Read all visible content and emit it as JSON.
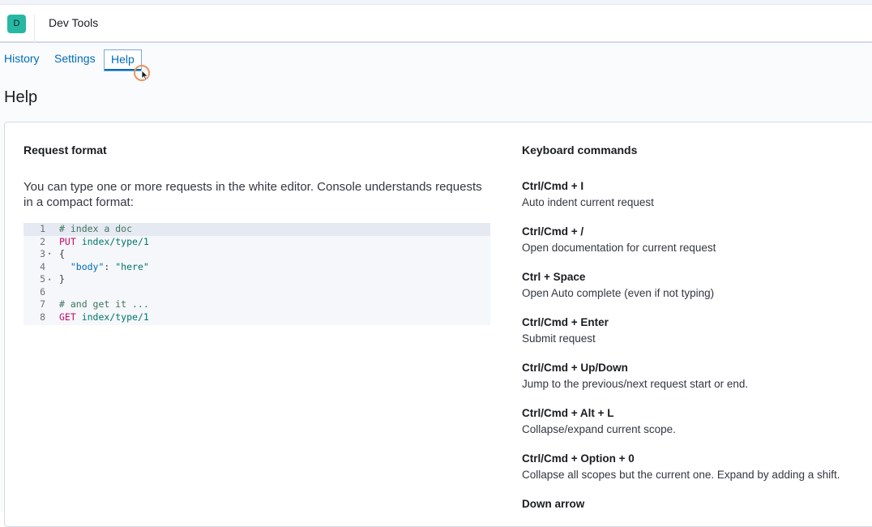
{
  "header": {
    "avatar_letter": "D",
    "app_title": "Dev Tools"
  },
  "tabs": [
    {
      "label": "History"
    },
    {
      "label": "Settings"
    },
    {
      "label": "Help",
      "selected": true
    }
  ],
  "page_title": "Help",
  "request_format": {
    "title": "Request format",
    "intro": "You can type one or more requests in the white editor. Console understands requests in a compact format:",
    "code": [
      {
        "n": "1",
        "fold": "",
        "text": "# index a doc"
      },
      {
        "n": "2",
        "fold": "",
        "text": "PUT index/type/1"
      },
      {
        "n": "3",
        "fold": "▾",
        "text": "{"
      },
      {
        "n": "4",
        "fold": "",
        "text": "  \"body\": \"here\""
      },
      {
        "n": "5",
        "fold": "▴",
        "text": "}"
      },
      {
        "n": "6",
        "fold": "",
        "text": ""
      },
      {
        "n": "7",
        "fold": "",
        "text": "# and get it ..."
      },
      {
        "n": "8",
        "fold": "",
        "text": "GET index/type/1"
      }
    ]
  },
  "keyboard_commands": {
    "title": "Keyboard commands",
    "items": [
      {
        "key": "Ctrl/Cmd + I",
        "desc": "Auto indent current request"
      },
      {
        "key": "Ctrl/Cmd + /",
        "desc": "Open documentation for current request"
      },
      {
        "key": "Ctrl + Space",
        "desc": "Open Auto complete (even if not typing)"
      },
      {
        "key": "Ctrl/Cmd + Enter",
        "desc": "Submit request"
      },
      {
        "key": "Ctrl/Cmd + Up/Down",
        "desc": "Jump to the previous/next request start or end."
      },
      {
        "key": "Ctrl/Cmd + Alt + L",
        "desc": "Collapse/expand current scope."
      },
      {
        "key": "Ctrl/Cmd + Option + 0",
        "desc": "Collapse all scopes but the current one. Expand by adding a shift."
      },
      {
        "key": "Down arrow",
        "desc": ""
      }
    ]
  },
  "colors": {
    "link": "#006bb8",
    "avatar_bg": "#27b8a3",
    "cursor_ring": "#f0915a"
  }
}
